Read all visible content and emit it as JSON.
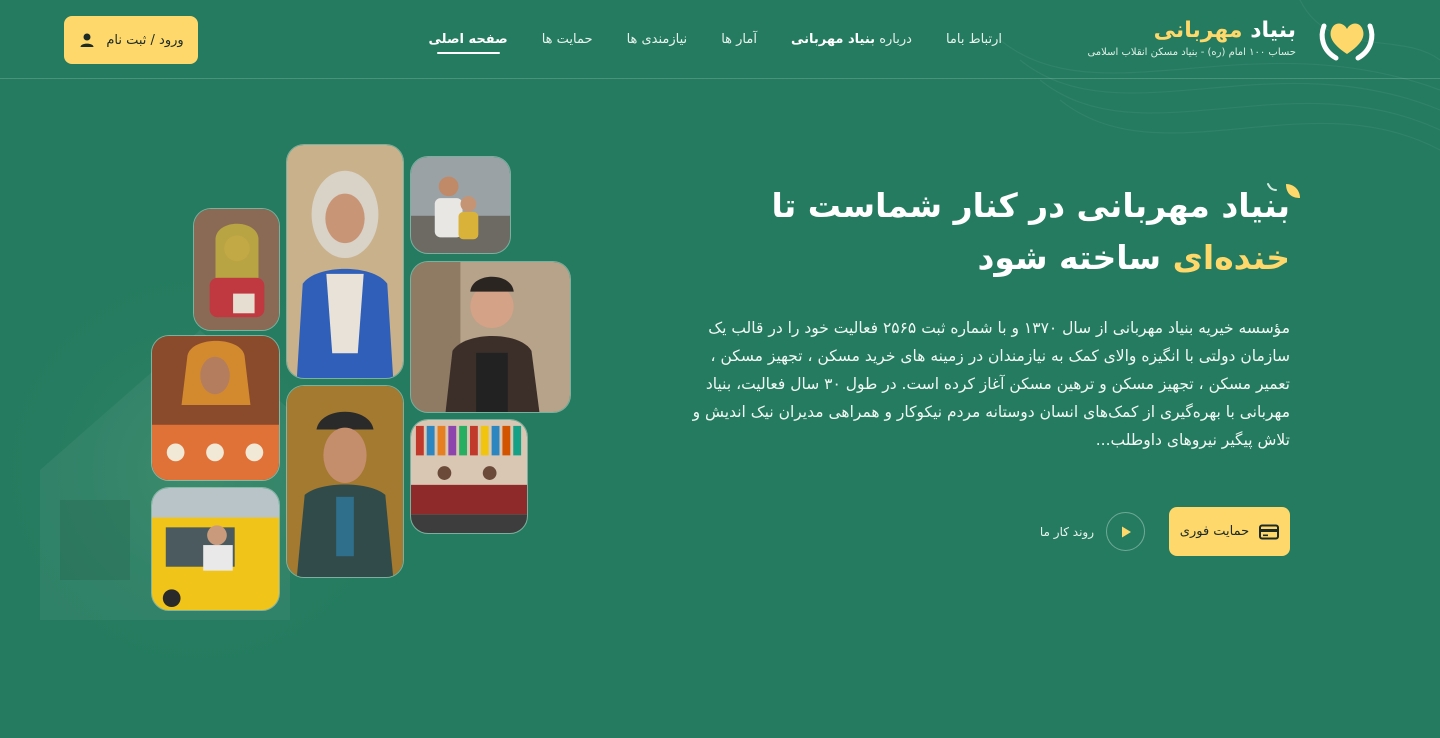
{
  "brand": {
    "name_part1": "بنیاد",
    "name_part2": "مهربانی",
    "subtitle": "حساب ۱۰۰ امام (ره) - بنیاد مسکن انقلاب اسلامی",
    "logo_icon": "heart-hands-icon"
  },
  "nav": {
    "items": [
      {
        "label": "صفحه اصلی",
        "active": true
      },
      {
        "label": "حمایت ها"
      },
      {
        "label": "نیازمندی ها"
      },
      {
        "label": "آمار ها"
      },
      {
        "label_prefix": "درباره",
        "label_bold": "بنیاد مهربانی"
      },
      {
        "label": "ارتباط باما"
      }
    ]
  },
  "auth": {
    "login_label": "ورود / ثبت نام",
    "icon": "user-icon"
  },
  "hero": {
    "title_line1": "بنیاد مهربانی در کنار شماست تا",
    "title_highlight": "خنده‌ای",
    "title_line2_rest": "ساخته شود",
    "description": "مؤسسه خیریه بنیاد مهربانی از سال ۱۳۷۰ و با شماره ثبت ۲۵۶۵ فعالیت خود را در قالب یک سازمان دولتی با انگیزه والای کمک به نیازمندان در زمینه های خرید مسکن ، تجهیز مسکن ، تعمیر مسکن ، تجهیز مسکن و ترهین مسکن آغاز کرده است. در طول ۳۰ سال فعالیت، بنیاد مهربانی با بهره‌گیری از کمک‌های انسان دوستانه مردم نیکوکار و همراهی مدیران نیک اندیش و تلاش پیگیر نیروهای داوطلب...",
    "primary_button": "حمایت فوری",
    "primary_icon": "card-icon",
    "secondary_link": "روند کار ما",
    "secondary_icon": "play-icon"
  },
  "colors": {
    "background": "#247b5f",
    "accent": "#ffd86b",
    "text": "#ffffff"
  }
}
